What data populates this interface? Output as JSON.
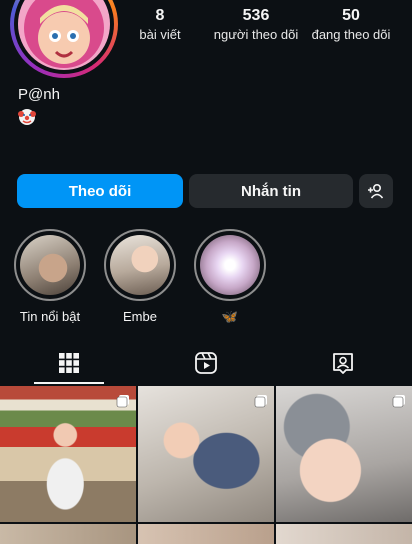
{
  "profile": {
    "username": "P@nh",
    "bio_emoji": "🤡"
  },
  "stats": [
    {
      "value": "8",
      "label": "bài viết"
    },
    {
      "value": "536",
      "label": "người theo dõi"
    },
    {
      "value": "50",
      "label": "đang theo dõi"
    }
  ],
  "actions": {
    "follow_label": "Theo dõi",
    "message_label": "Nhắn tin",
    "add_person_icon": "add-person-icon"
  },
  "highlights": [
    {
      "label": "Tin nổi bật"
    },
    {
      "label": "Embe"
    },
    {
      "label": "🦋"
    }
  ],
  "tabs": [
    {
      "icon": "grid-icon",
      "active": true
    },
    {
      "icon": "reels-icon",
      "active": false
    },
    {
      "icon": "tagged-icon",
      "active": false
    }
  ],
  "colors": {
    "background": "#0c1014",
    "accent": "#0095f6",
    "secondary_button": "#262a2e"
  }
}
